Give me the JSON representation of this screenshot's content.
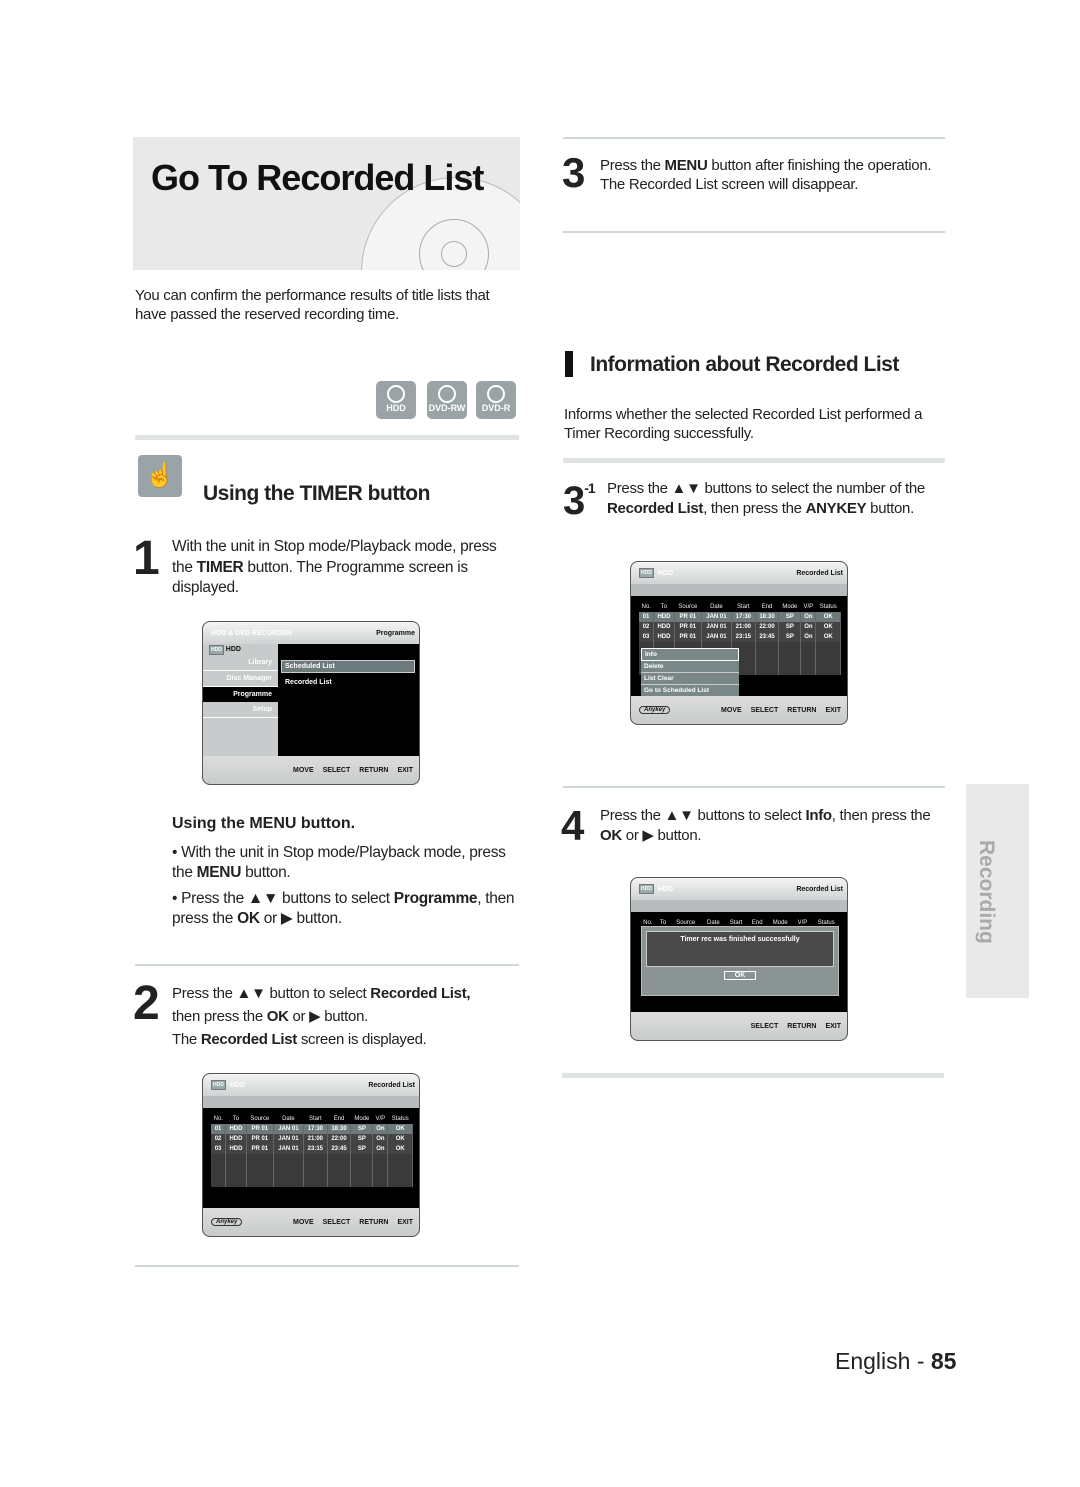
{
  "title": "Go To Recorded List",
  "intro": "You can confirm the performance results of title lists that have passed the reserved recording time.",
  "badges": [
    "HDD",
    "DVD-RW",
    "DVD-R"
  ],
  "timer_section": {
    "title": "Using the TIMER button",
    "step1": {
      "num": "1",
      "pre": "With the unit in Stop mode/Playback mode, press the ",
      "b": "TIMER",
      "post": " button. The Programme screen is displayed."
    }
  },
  "menu_section": {
    "title": "Using the MENU button.",
    "b1": {
      "pre": "• With the unit in Stop mode/Playback mode, press the ",
      "b": "MENU",
      "post": " button."
    },
    "b2": {
      "pre": "• Press the ▲▼ buttons to select ",
      "b": "Programme",
      "mid": ", then press the ",
      "b2": "OK",
      "post": " or ▶ button."
    }
  },
  "step2": {
    "num": "2",
    "pre": "Press the ▲▼ button to select ",
    "b": "Recorded List,",
    "mid": " then press the ",
    "b2": "OK",
    "post": " or ▶ button.",
    "line2pre": "The ",
    "line2b": "Recorded List",
    "line2post": " screen is displayed."
  },
  "step3": {
    "num": "3",
    "pre": "Press the ",
    "b": "MENU",
    "post": " button after finishing the operation.",
    "line2": "The Recorded List screen will disappear."
  },
  "info_section": {
    "title": "Information about Recorded List",
    "desc": "Informs whether the selected Recorded List performed a Timer Recording successfully."
  },
  "step3_1": {
    "num": "3",
    "sub": "-1",
    "pre": "Press the ▲▼ buttons to select the number of the ",
    "b": "Recorded List",
    "mid": ", then press the ",
    "b2": "ANYKEY",
    "post": " button."
  },
  "step4": {
    "num": "4",
    "pre": "Press the ▲▼ buttons to select ",
    "b": "Info",
    "mid": ", then press the ",
    "b2": "OK",
    "post": " or ▶ button."
  },
  "programme_screen": {
    "header_left": "HDD & DVD RECORDER",
    "header_right": "Programme",
    "hdd": "HDD",
    "menu": [
      "Library",
      "Disc Manager",
      "Programme",
      "Setup"
    ],
    "submenu": [
      "Scheduled List",
      "Recorded List"
    ],
    "footer": [
      "MOVE",
      "SELECT",
      "RETURN",
      "EXIT"
    ]
  },
  "recorded_list": {
    "header_left": "HDD",
    "header_right": "Recorded List",
    "columns": [
      "No.",
      "To",
      "Source",
      "Date",
      "Start",
      "End",
      "Mode",
      "V/P",
      "Status"
    ],
    "rows": [
      [
        "01",
        "HDD",
        "PR 01",
        "JAN 01",
        "17:30",
        "18:30",
        "SP",
        "On",
        "OK"
      ],
      [
        "02",
        "HDD",
        "PR 01",
        "JAN 01",
        "21:00",
        "22:00",
        "SP",
        "On",
        "OK"
      ],
      [
        "03",
        "HDD",
        "PR 01",
        "JAN 01",
        "23:15",
        "23:45",
        "SP",
        "On",
        "OK"
      ]
    ],
    "anykey": "Anykey",
    "footer": [
      "MOVE",
      "SELECT",
      "RETURN",
      "EXIT"
    ],
    "popup": [
      "Info",
      "Delete",
      "List Clear",
      "Go to Scheduled List"
    ],
    "message": "Timer rec was finished successfully",
    "ok": "OK",
    "footer_info": [
      "SELECT",
      "RETURN",
      "EXIT"
    ]
  },
  "sidebar_tab": "Recording",
  "footer": {
    "lang": "English - ",
    "page": "85"
  }
}
